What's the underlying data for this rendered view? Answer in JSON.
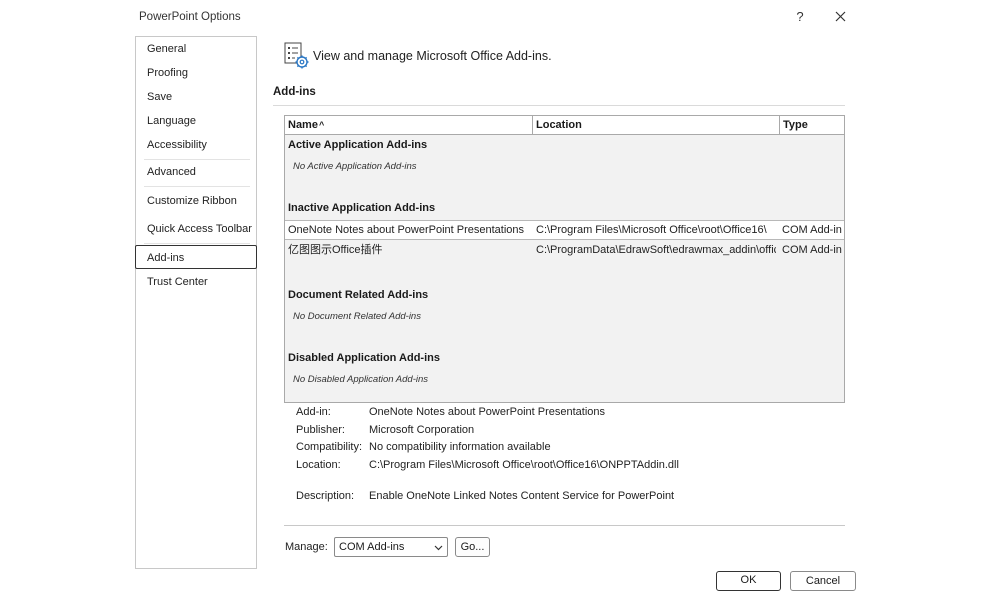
{
  "window": {
    "title": "PowerPoint Options",
    "help_label": "?"
  },
  "sidebar": {
    "items": [
      {
        "label": "General"
      },
      {
        "label": "Proofing"
      },
      {
        "label": "Save"
      },
      {
        "label": "Language"
      },
      {
        "label": "Accessibility"
      },
      {
        "label": "Advanced"
      },
      {
        "label": "Customize Ribbon"
      },
      {
        "label": "Quick Access Toolbar"
      },
      {
        "label": "Add-ins",
        "selected": true
      },
      {
        "label": "Trust Center"
      }
    ]
  },
  "header": {
    "text": "View and manage Microsoft Office Add-ins.",
    "icon": "addins-settings-icon"
  },
  "section": {
    "title": "Add-ins"
  },
  "grid": {
    "columns": {
      "name": "Name",
      "sort_indicator": "^",
      "location": "Location",
      "type": "Type"
    },
    "groups": {
      "active": {
        "title": "Active Application Add-ins",
        "empty": "No Active Application Add-ins"
      },
      "inactive": {
        "title": "Inactive Application Add-ins",
        "rows": [
          {
            "name": "OneNote Notes about PowerPoint Presentations",
            "location": "C:\\Program Files\\Microsoft Office\\root\\Office16\\",
            "type": "COM Add-in",
            "selected": true
          },
          {
            "name": "亿图图示Office插件",
            "location": "C:\\ProgramData\\EdrawSoft\\edrawmax_addin\\offic",
            "type": "COM Add-in",
            "selected": false
          }
        ]
      },
      "document": {
        "title": "Document Related Add-ins",
        "empty": "No Document Related Add-ins"
      },
      "disabled": {
        "title": "Disabled Application Add-ins",
        "empty": "No Disabled Application Add-ins"
      }
    }
  },
  "details": {
    "addin_label": "Add-in:",
    "addin_value": "OneNote Notes about PowerPoint Presentations",
    "publisher_label": "Publisher:",
    "publisher_value": "Microsoft Corporation",
    "compat_label": "Compatibility:",
    "compat_value": "No compatibility information available",
    "location_label": "Location:",
    "location_value": "C:\\Program Files\\Microsoft Office\\root\\Office16\\ONPPTAddin.dll",
    "description_label": "Description:",
    "description_value": "Enable OneNote Linked Notes Content Service for PowerPoint"
  },
  "manage": {
    "label": "Manage:",
    "selected": "COM Add-ins",
    "go_label": "Go..."
  },
  "footer": {
    "ok_label": "OK",
    "cancel_label": "Cancel"
  }
}
